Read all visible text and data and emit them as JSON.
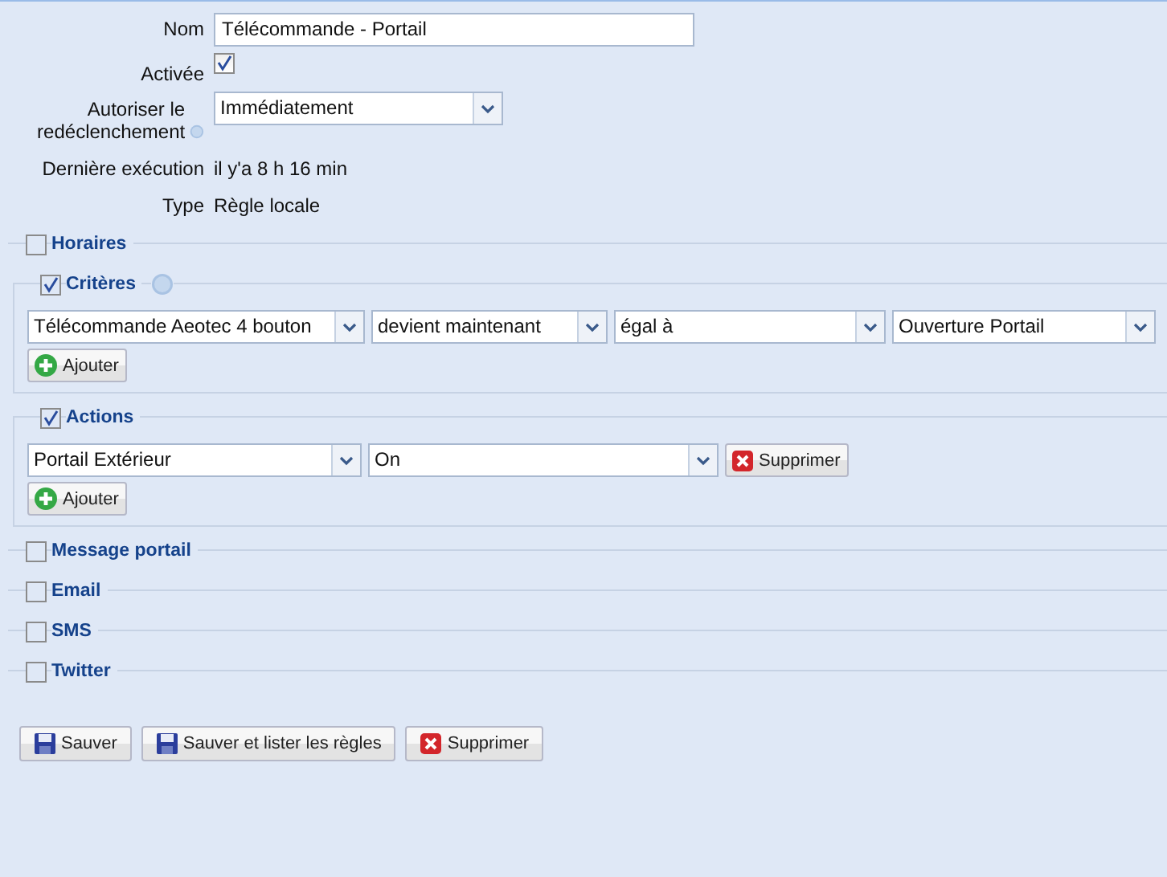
{
  "form": {
    "fields": [
      {
        "kind": "text",
        "label": "Nom",
        "value": "Télécommande - Portail"
      },
      {
        "kind": "checkbox",
        "label": "Activée",
        "checked": true
      },
      {
        "kind": "select",
        "label": "Autoriser le redéclenchement",
        "help": true,
        "value": "Immédiatement"
      },
      {
        "kind": "static",
        "label": "Dernière exécution",
        "value": "il y'a 8 h 16 min"
      },
      {
        "kind": "static",
        "label": "Type",
        "value": "Règle locale"
      }
    ]
  },
  "sections": [
    {
      "title": "Horaires",
      "checked": false
    },
    {
      "title": "Critères",
      "checked": true,
      "help": true,
      "rows": [
        {
          "selects": [
            "Télécommande Aeotec 4 bouton",
            "devient maintenant",
            "égal à",
            "Ouverture Portail"
          ]
        }
      ],
      "add_button": "Ajouter"
    },
    {
      "title": "Actions",
      "checked": true,
      "rows": [
        {
          "selects": [
            "Portail Extérieur",
            "On"
          ],
          "delete_button": "Supprimer"
        }
      ],
      "add_button": "Ajouter"
    },
    {
      "title": "Message portail",
      "checked": false
    },
    {
      "title": "Email",
      "checked": false
    },
    {
      "title": "SMS",
      "checked": false
    },
    {
      "title": "Twitter",
      "checked": false
    }
  ],
  "footer_buttons": [
    {
      "kind": "save",
      "label": "Sauver"
    },
    {
      "kind": "save",
      "label": "Sauver et lister les règles"
    },
    {
      "kind": "delete",
      "label": "Supprimer"
    }
  ]
}
